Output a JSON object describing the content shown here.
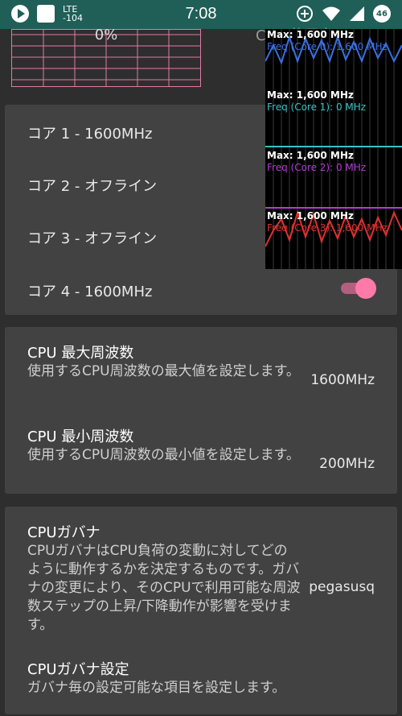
{
  "status_bar": {
    "network": "LTE",
    "signal_dbm": "-104",
    "time": "7:08",
    "battery": "46"
  },
  "usage_graph": {
    "percent": "0%",
    "label": "CPU 使用率"
  },
  "cores": [
    {
      "label": "コア 1 - 1600MHz",
      "enabled": true
    },
    {
      "label": "コア 2 - オフライン",
      "enabled": false
    },
    {
      "label": "コア 3 - オフライン",
      "enabled": false
    },
    {
      "label": "コア 4 - 1600MHz",
      "enabled": true
    }
  ],
  "freq_settings": {
    "max": {
      "title": "CPU 最大周波数",
      "description": "使用するCPU周波数の最大値を設定します。",
      "value": "1600MHz"
    },
    "min": {
      "title": "CPU 最小周波数",
      "description": "使用するCPU周波数の最小値を設定します。",
      "value": "200MHz"
    }
  },
  "governor": {
    "title": "CPUガバナ",
    "description": "CPUガバナはCPU負荷の変動に対してどのように動作するかを決定するものです。ガバナの変更により、そのCPUで利用可能な周波数ステップの上昇/下降動作が影響を受けます。",
    "value": "pegasusq",
    "settings_title": "CPUガバナ設定",
    "settings_description": "ガバナ毎の設定可能な項目を設定します。"
  },
  "overlay": {
    "panels": [
      {
        "max": "Max: 1,600 MHz",
        "freq": "Freq (Core 0): 1,600 MHz",
        "color": "#3a6fe0"
      },
      {
        "max": "Max: 1,600 MHz",
        "freq": "Freq (Core 1): 0 MHz",
        "color": "#33c5c5"
      },
      {
        "max": "Max: 1,600 MHz",
        "freq": "Freq (Core 2): 0 MHz",
        "color": "#b53ad8"
      },
      {
        "max": "Max: 1,600 MHz",
        "freq": "Freq (Core 3): 1,600 MHz",
        "color": "#e03030"
      }
    ]
  },
  "colors": {
    "accent": "#ff7aa8",
    "status_bar": "#1f5f58",
    "card": "#424242",
    "background": "#2e2e2e"
  }
}
